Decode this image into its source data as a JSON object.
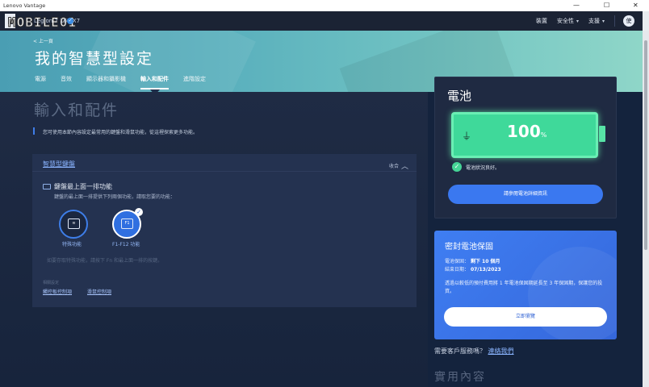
{
  "window": {
    "title": "Lenovo Vantage",
    "controls": {
      "minimize": "—",
      "maximize": "☐",
      "close": "✕"
    }
  },
  "topbar": {
    "watermark": "MOBILE01",
    "device": "Legion 7 16IAX7",
    "nav": [
      {
        "label": "裝置",
        "has_caret": false
      },
      {
        "label": "安全性",
        "has_caret": true
      },
      {
        "label": "支援",
        "has_caret": true
      }
    ],
    "user_initial": "使"
  },
  "header": {
    "back": "< 上一頁",
    "title": "我的智慧型設定",
    "tabs": [
      "電源",
      "音效",
      "顯示器和攝影機",
      "輸入和配件",
      "進階設定"
    ],
    "active_tab": 3
  },
  "main": {
    "section_title": "輸入和配件",
    "intro": "您可使用本節內容設定最常用的鍵盤和滑鼠功能，從這裡探索更多功能。",
    "card": {
      "title": "智慧型鍵盤",
      "collapse_label": "收合",
      "feature_title": "鍵盤最上面一排功能",
      "feature_desc": "鍵盤的最上面一排提供下列兩個功能，請取您要的功能：",
      "options": [
        {
          "label": "特殊功能",
          "icon_text": "≋",
          "selected": false
        },
        {
          "label": "F1-F12 功能",
          "icon_text": "F1",
          "selected": true
        }
      ],
      "hint": "如要存取特殊功能，請按下 Fn 和最上面一排的按鍵。",
      "related_label": "相關設定",
      "related_links": [
        "觸控板控制項",
        "滑鼠控制項"
      ]
    }
  },
  "battery": {
    "title": "電池",
    "percent": "100",
    "percent_sign": "%",
    "status": "電池狀況良好。",
    "button": "請參閱電池詳細資訊"
  },
  "warranty": {
    "title": "密封電池保固",
    "line1_label": "電池保固：",
    "line1_value": "剩下 10 個月",
    "line2_label": "結束日期：",
    "line2_value": "07/13/2023",
    "desc": "透過以較低的預付費用將 1 年電池保固期延長至 3 年保固期，保護您的投資。",
    "button": "立即瀏覽"
  },
  "help": {
    "text": "需要客戶服務嗎？",
    "link": "連絡我們"
  },
  "useful": "實用內容",
  "colors": {
    "accent": "#3a78f0",
    "battery_green": "#3fd99a",
    "header_teal": "#5ab0bd",
    "bg_dark": "#14233d"
  }
}
